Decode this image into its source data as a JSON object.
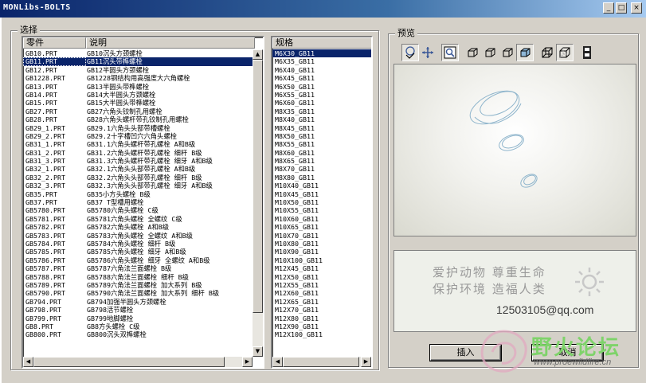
{
  "window": {
    "title": "MONLibs-BOLTS",
    "minimize_glyph": "_",
    "maximize_glyph": "□",
    "close_glyph": "×"
  },
  "selection": {
    "group_label": "选择",
    "columns": {
      "part": "零件",
      "description": "说明"
    },
    "rows": [
      {
        "part": "GB10.PRT",
        "desc": "GB10沉头方颈螺栓"
      },
      {
        "part": "GB11.PRT",
        "desc": "GB11沉头带榫螺栓",
        "selected": true
      },
      {
        "part": "GB12.PRT",
        "desc": "GB12半圆头方颈螺栓"
      },
      {
        "part": "GB1228.PRT",
        "desc": "GB1228钢结构用高强度大六角螺栓"
      },
      {
        "part": "GB13.PRT",
        "desc": "GB13半圆头带榫螺栓"
      },
      {
        "part": "GB14.PRT",
        "desc": "GB14大半圆头方颈螺栓"
      },
      {
        "part": "GB15.PRT",
        "desc": "GB15大半圆头带榫螺栓"
      },
      {
        "part": "GB27.PRT",
        "desc": "GB27六角头铰制孔用螺栓"
      },
      {
        "part": "GB28.PRT",
        "desc": "GB28六角头螺杆带孔铰制孔用螺栓"
      },
      {
        "part": "GB29_1.PRT",
        "desc": "GB29.1六角头头部带槽螺栓"
      },
      {
        "part": "GB29_2.PRT",
        "desc": "GB29.2十字槽凹穴六角头螺栓"
      },
      {
        "part": "GB31_1.PRT",
        "desc": "GB31.1六角头螺杆带孔螺栓 A和B级"
      },
      {
        "part": "GB31_2.PRT",
        "desc": "GB31.2六角头螺杆带孔螺栓 细杆 B级"
      },
      {
        "part": "GB31_3.PRT",
        "desc": "GB31.3六角头螺杆带孔螺栓 细牙 A和B级"
      },
      {
        "part": "GB32_1.PRT",
        "desc": "GB32.1六角头头部带孔螺栓 A和B级"
      },
      {
        "part": "GB32_2.PRT",
        "desc": "GB32.2六角头头部带孔螺栓 细杆 B级"
      },
      {
        "part": "GB32_3.PRT",
        "desc": "GB32.3六角头头部带孔螺栓 细牙 A和B级"
      },
      {
        "part": "GB35.PRT",
        "desc": "GB35小方头螺栓 B级"
      },
      {
        "part": "GB37.PRT",
        "desc": "GB37 T型槽用螺栓"
      },
      {
        "part": "GB5780.PRT",
        "desc": "GB5780六角头螺栓 C级"
      },
      {
        "part": "GB5781.PRT",
        "desc": "GB5781六角头螺栓 全螺纹 C级"
      },
      {
        "part": "GB5782.PRT",
        "desc": "GB5782六角头螺栓 A和B级"
      },
      {
        "part": "GB5783.PRT",
        "desc": "GB5783六角头螺栓 全螺纹 A和B级"
      },
      {
        "part": "GB5784.PRT",
        "desc": "GB5784六角头螺栓 细杆 B级"
      },
      {
        "part": "GB5785.PRT",
        "desc": "GB5785六角头螺栓 细牙 A和B级"
      },
      {
        "part": "GB5786.PRT",
        "desc": "GB5786六角头螺栓 细牙 全螺纹 A和B级"
      },
      {
        "part": "GB5787.PRT",
        "desc": "GB5787六角法兰面螺栓 B级"
      },
      {
        "part": "GB5788.PRT",
        "desc": "GB5788六角法兰面螺栓 细杆 B级"
      },
      {
        "part": "GB5789.PRT",
        "desc": "GB5789六角法兰面螺栓 加大系列 B级"
      },
      {
        "part": "GB5790.PRT",
        "desc": "GB5790六角法兰面螺栓 加大系列 细杆 B级"
      },
      {
        "part": "GB794.PRT",
        "desc": "GB794加强半圆头方颈螺栓"
      },
      {
        "part": "GB798.PRT",
        "desc": "GB798活节螺栓"
      },
      {
        "part": "GB799.PRT",
        "desc": "GB799地脚螺栓"
      },
      {
        "part": "GB8.PRT",
        "desc": "GB8方头螺栓 C级"
      },
      {
        "part": "GB800.PRT",
        "desc": "GB800沉头双榫螺栓"
      }
    ]
  },
  "specs": {
    "header": "规格",
    "items": [
      {
        "label": "M6X30_GB11",
        "selected": true
      },
      {
        "label": "M6X35_GB11"
      },
      {
        "label": "M6X40_GB11"
      },
      {
        "label": "M6X45_GB11"
      },
      {
        "label": "M6X50_GB11"
      },
      {
        "label": "M6X55_GB11"
      },
      {
        "label": "M6X60_GB11"
      },
      {
        "label": "M8X35_GB11"
      },
      {
        "label": "M8X40_GB11"
      },
      {
        "label": "M8X45_GB11"
      },
      {
        "label": "M8X50_GB11"
      },
      {
        "label": "M8X55_GB11"
      },
      {
        "label": "M8X60_GB11"
      },
      {
        "label": "M8X65_GB11"
      },
      {
        "label": "M8X70_GB11"
      },
      {
        "label": "M8X80_GB11"
      },
      {
        "label": "M10X40_GB11"
      },
      {
        "label": "M10X45_GB11"
      },
      {
        "label": "M10X50_GB11"
      },
      {
        "label": "M10X55_GB11"
      },
      {
        "label": "M10X60_GB11"
      },
      {
        "label": "M10X65_GB11"
      },
      {
        "label": "M10X70_GB11"
      },
      {
        "label": "M10X80_GB11"
      },
      {
        "label": "M10X90_GB11"
      },
      {
        "label": "M10X100_GB11"
      },
      {
        "label": "M12X45_GB11"
      },
      {
        "label": "M12X50_GB11"
      },
      {
        "label": "M12X55_GB11"
      },
      {
        "label": "M12X60_GB11"
      },
      {
        "label": "M12X65_GB11"
      },
      {
        "label": "M12X70_GB11"
      },
      {
        "label": "M12X80_GB11"
      },
      {
        "label": "M12X90_GB11"
      },
      {
        "label": "M12X100_GB11"
      }
    ]
  },
  "preview": {
    "group_label": "预览",
    "toolbar": [
      "spin-view-icon",
      "pan-view-icon",
      "zoom-window-icon",
      "view-front-icon",
      "view-side-icon",
      "view-top-icon",
      "shaded-cube-icon",
      "wireframe-cube-icon",
      "hidden-line-cube-icon",
      "film-strip-icon"
    ]
  },
  "info": {
    "line1": "爱护动物 尊重生命",
    "line2": "保护环境 造福人类",
    "email": "12503105@qq.com"
  },
  "buttons": {
    "insert": "插入",
    "cancel": "取消"
  },
  "watermark": {
    "text": "野火论坛",
    "url": "www.proewildfire.cn"
  },
  "colors": {
    "selection": "#0a246a",
    "watermark": "#7ed36a",
    "face": "#d4d0c8"
  }
}
